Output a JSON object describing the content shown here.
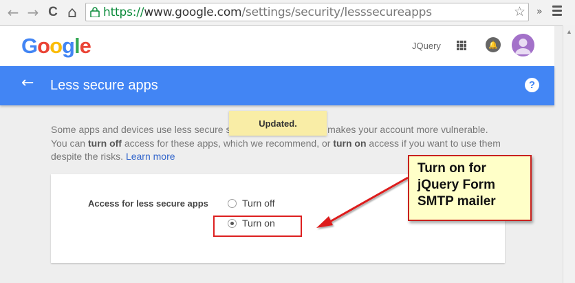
{
  "browser": {
    "url_scheme": "https://",
    "url_host": "www.google.com",
    "url_path": "/settings/security/lesssecureapps",
    "back_glyph": "←",
    "forward_glyph": "→",
    "reload_glyph": "C",
    "home_glyph": "⌂",
    "star_glyph": "☆",
    "extensions_glyph": "»"
  },
  "header": {
    "logo": [
      "G",
      "o",
      "o",
      "g",
      "l",
      "e"
    ],
    "logo_colors": [
      "#4285f4",
      "#ea4335",
      "#fbbc05",
      "#4285f4",
      "#34a853",
      "#ea4335"
    ],
    "username": "JQuery"
  },
  "page_bar": {
    "title": "Less secure apps",
    "back_glyph": "←",
    "help_glyph": "?"
  },
  "toast": {
    "text": "Updated."
  },
  "description": {
    "line1_a": "Some apps and devices use less secure s",
    "line1_b": "ch makes your account more vulnerable.",
    "line2_a": "You can ",
    "line2_b": "turn off",
    "line2_c": " access for these apps, which we recommend, or ",
    "line2_d": "turn on",
    "line2_e": " access if you want to use them",
    "line3_a": "despite the risks. ",
    "learn_more": "Learn more"
  },
  "setting": {
    "label": "Access for less secure apps",
    "options": [
      {
        "label": "Turn off",
        "checked": false
      },
      {
        "label": "Turn on",
        "checked": true
      }
    ]
  },
  "annotation": {
    "callout_lines": [
      "Turn on for",
      "jQuery Form",
      "SMTP mailer"
    ],
    "color": "#dd1f1f"
  }
}
